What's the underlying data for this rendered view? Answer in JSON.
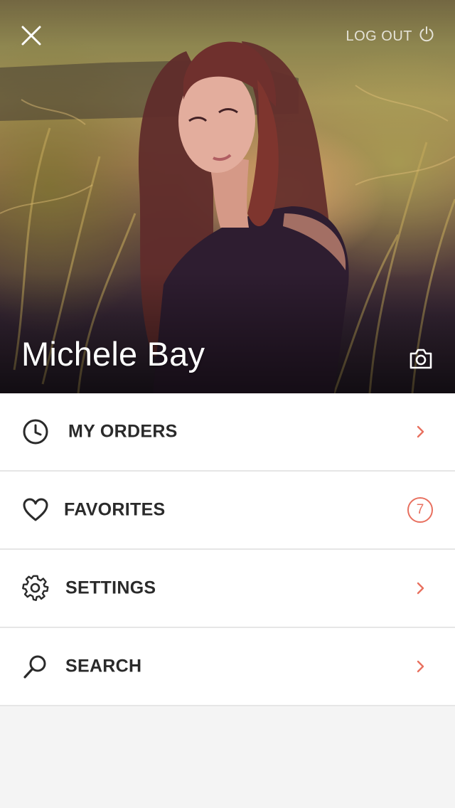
{
  "hero": {
    "logout_label": "LOG OUT",
    "profile_name": "Michele Bay"
  },
  "menu": {
    "items": [
      {
        "label": "MY ORDERS",
        "icon": "clock-icon"
      },
      {
        "label": "FAVORITES",
        "icon": "heart-icon",
        "badge": "7"
      },
      {
        "label": "SETTINGS",
        "icon": "gear-icon"
      },
      {
        "label": "SEARCH",
        "icon": "search-icon"
      }
    ]
  },
  "colors": {
    "accent": "#e8705f",
    "text": "#2a2a2a",
    "divider": "#e6e6e6",
    "background": "#f4f4f4"
  }
}
